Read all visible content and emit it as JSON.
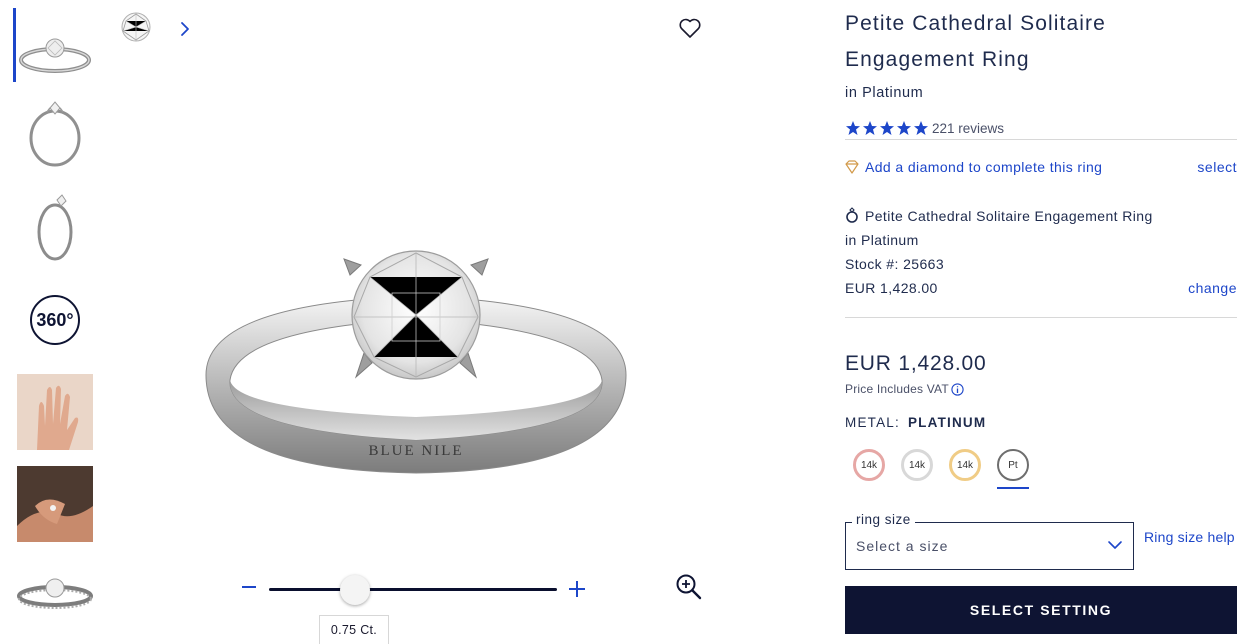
{
  "product": {
    "title": "Petite Cathedral Solitaire Engagement Ring",
    "metal_subtitle": "in Platinum",
    "rating_stars": 5,
    "reviews": "221 reviews"
  },
  "gallery": {
    "thumbnails": [
      "ring-angle-view",
      "ring-front-view",
      "ring-side-view",
      "360-view",
      "hand-view",
      "model-view",
      "ring-band-view"
    ],
    "view_360_label": "360°",
    "brand_engraving": "BLUE NILE",
    "carat_tooltip": "0.75 Ct.",
    "zoom_level": 0.3
  },
  "diamond_prompt": {
    "text": "Add a diamond to complete this ring",
    "action": "select"
  },
  "setting_summary": {
    "name": "Petite Cathedral Solitaire Engagement Ring",
    "metal": "in Platinum",
    "stock": "Stock #: 25663",
    "price": "EUR 1,428.00",
    "action": "change"
  },
  "pricing": {
    "price": "EUR 1,428.00",
    "vat_note": "Price Includes VAT"
  },
  "metal": {
    "label": "METAL:",
    "selected": "PLATINUM",
    "options": [
      {
        "label": "14k",
        "color": "#e6a7a5"
      },
      {
        "label": "14k",
        "color": "#d8d8d8"
      },
      {
        "label": "14k",
        "color": "#f0cc86"
      },
      {
        "label": "Pt",
        "color": "#6e6e6e"
      }
    ]
  },
  "ring_size": {
    "label": "ring size",
    "placeholder": "Select a size",
    "help": "Ring size help"
  },
  "cta": {
    "label": "SELECT SETTING"
  },
  "colors": {
    "accent_blue": "#1d46c9",
    "navy": "#0e1433",
    "text": "#1f2b4d"
  }
}
